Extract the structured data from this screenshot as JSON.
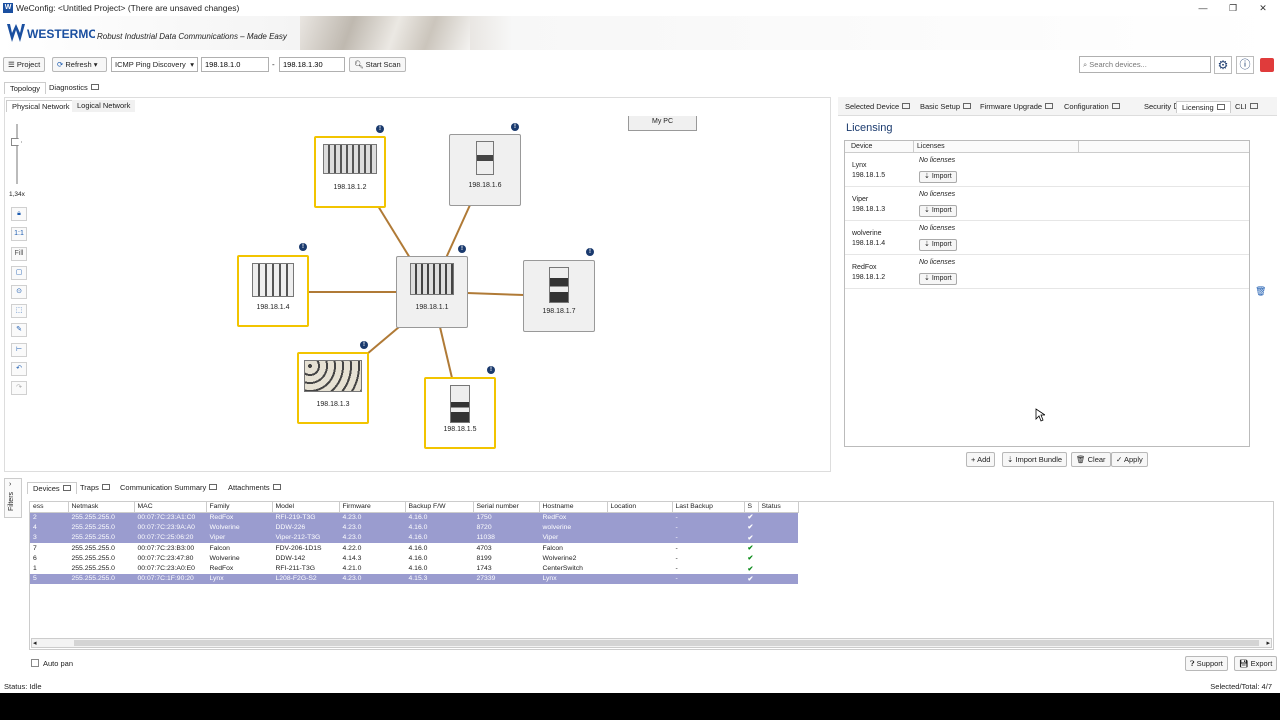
{
  "window": {
    "title": "WeConfig: <Untitled Project> (There are unsaved changes)",
    "controls": [
      "—",
      "❐",
      "✕"
    ]
  },
  "banner": {
    "logo_text": "WESTERMO",
    "tagline": "Robust Industrial Data Communications – Made Easy"
  },
  "toolbar": {
    "project_label": "Project",
    "refresh_label": "Refresh",
    "discovery_method": "ICMP Ping Discovery",
    "ip_from": "198.18.1.0",
    "ip_separator": "-",
    "ip_to": "198.18.1.30",
    "start_scan_label": "Start Scan",
    "search_placeholder": "Search devices..."
  },
  "main_tabs": [
    "Topology",
    "Diagnostics"
  ],
  "topology_tabs": [
    "Physical Network",
    "Logical Network"
  ],
  "zoom_level": "1,34x",
  "side_tools": [
    "1:1",
    "Fill"
  ],
  "mypc_label": "My PC",
  "devices_map": [
    {
      "ip": "198.18.1.2",
      "selected": true
    },
    {
      "ip": "198.18.1.6",
      "selected": false
    },
    {
      "ip": "198.18.1.4",
      "selected": true
    },
    {
      "ip": "198.18.1.1",
      "selected": false
    },
    {
      "ip": "198.18.1.7",
      "selected": false
    },
    {
      "ip": "198.18.1.3",
      "selected": true
    },
    {
      "ip": "198.18.1.5",
      "selected": true
    }
  ],
  "right_tabs": [
    "Selected Device",
    "Basic Setup",
    "Firmware Upgrade",
    "Configuration",
    "Security",
    "Licensing",
    "CLI"
  ],
  "licensing": {
    "title": "Licensing",
    "col_device": "Device",
    "col_licenses": "Licenses",
    "rows": [
      {
        "name": "Lynx",
        "ip": "198.18.1.5",
        "status": "No licenses",
        "action": "Import"
      },
      {
        "name": "Viper",
        "ip": "198.18.1.3",
        "status": "No licenses",
        "action": "Import"
      },
      {
        "name": "wolverine",
        "ip": "198.18.1.4",
        "status": "No licenses",
        "action": "Import"
      },
      {
        "name": "RedFox",
        "ip": "198.18.1.2",
        "status": "No licenses",
        "action": "Import"
      }
    ],
    "add_label": "Add",
    "import_bundle_label": "Import Bundle",
    "clear_label": "Clear",
    "apply_label": "Apply"
  },
  "bottom_tabs": [
    "Devices",
    "Traps",
    "Communication Summary",
    "Attachments"
  ],
  "filters_label": "Filters",
  "grid": {
    "headers": [
      "ess",
      "Netmask",
      "MAC",
      "Family",
      "Model",
      "Firmware",
      "Backup F/W",
      "Serial number",
      "Hostname",
      "Location",
      "Last Backup",
      "S",
      "Status"
    ],
    "rows": [
      {
        "sel": true,
        "cells": [
          "2",
          "255.255.255.0",
          "00:07:7C:23:A1:C0",
          "RedFox",
          "RFI-219-T3G",
          "4.23.0",
          "4.16.0",
          "1750",
          "RedFox",
          "",
          "-",
          "✔",
          ""
        ]
      },
      {
        "sel": true,
        "cells": [
          "4",
          "255.255.255.0",
          "00:07:7C:23:9A:A0",
          "Wolverine",
          "DDW-226",
          "4.23.0",
          "4.16.0",
          "8720",
          "wolverine",
          "",
          "-",
          "✔",
          ""
        ]
      },
      {
        "sel": true,
        "cells": [
          "3",
          "255.255.255.0",
          "00:07:7C:25:06:20",
          "Viper",
          "Viper-212-T3G",
          "4.23.0",
          "4.16.0",
          "11038",
          "Viper",
          "",
          "-",
          "✔",
          ""
        ]
      },
      {
        "sel": false,
        "cells": [
          "7",
          "255.255.255.0",
          "00:07:7C:23:B3:00",
          "Falcon",
          "FDV-206-1D1S",
          "4.22.0",
          "4.16.0",
          "4703",
          "Falcon",
          "",
          "-",
          "✔",
          ""
        ]
      },
      {
        "sel": false,
        "cells": [
          "6",
          "255.255.255.0",
          "00:07:7C:23:47:80",
          "Wolverine",
          "DDW-142",
          "4.14.3",
          "4.16.0",
          "8199",
          "Wolverine2",
          "",
          "-",
          "✔",
          ""
        ]
      },
      {
        "sel": false,
        "cells": [
          "1",
          "255.255.255.0",
          "00:07:7C:23:A0:E0",
          "RedFox",
          "RFI-211-T3G",
          "4.21.0",
          "4.16.0",
          "1743",
          "CenterSwitch",
          "",
          "-",
          "✔",
          ""
        ]
      },
      {
        "sel": true,
        "cells": [
          "5",
          "255.255.255.0",
          "00:07:7C:1F:90:20",
          "Lynx",
          "L208-F2G-S2",
          "4.23.0",
          "4.15.3",
          "27339",
          "Lynx",
          "",
          "-",
          "✔",
          ""
        ]
      }
    ]
  },
  "auto_pan_label": "Auto pan",
  "support_label": "Support",
  "export_label": "Export",
  "status": {
    "left": "Status: Idle",
    "right": "Selected/Total: 4/7"
  },
  "colors": {
    "accent": "#1b5bb0",
    "selection": "#f2c400",
    "row_selected": "#9a9ccf",
    "link_line": "#b07a36"
  }
}
